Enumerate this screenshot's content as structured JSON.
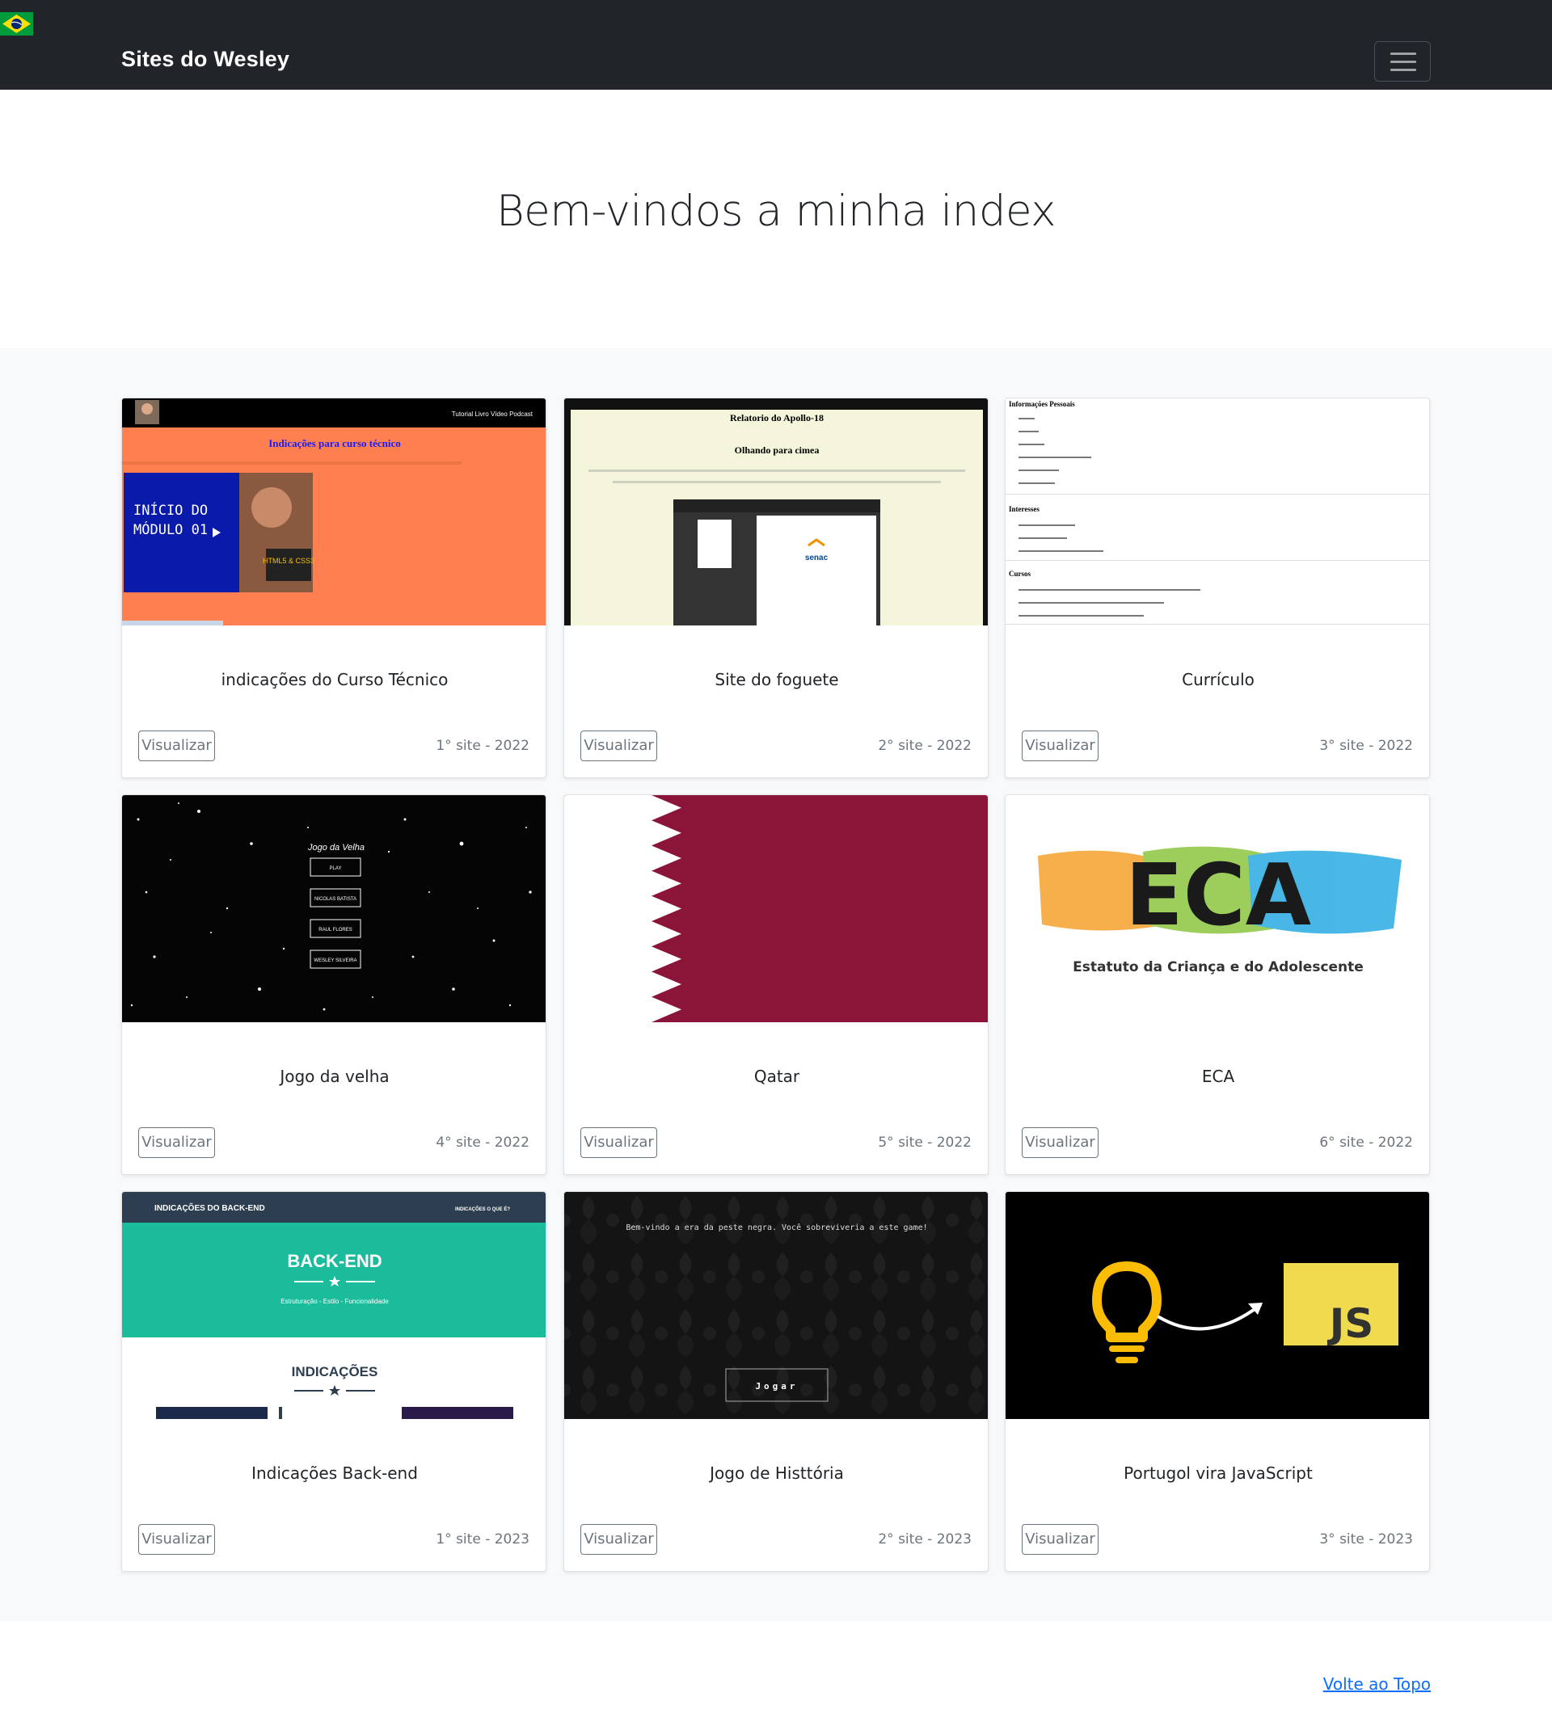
{
  "navbar": {
    "brand": "Sites do Wesley",
    "flag_icon": "brazil-flag-icon",
    "toggler_icon": "hamburger-menu-icon"
  },
  "hero": {
    "title": "Bem-vindos a minha index"
  },
  "cards": [
    {
      "title": "indicações do Curso Técnico",
      "button": "Visualizar",
      "meta": "1° site - 2022"
    },
    {
      "title": "Site do foguete",
      "button": "Visualizar",
      "meta": "2° site - 2022"
    },
    {
      "title": "Currículo",
      "button": "Visualizar",
      "meta": "3° site - 2022"
    },
    {
      "title": "Jogo da velha",
      "button": "Visualizar",
      "meta": "4° site - 2022"
    },
    {
      "title": "Qatar",
      "button": "Visualizar",
      "meta": "5° site - 2022"
    },
    {
      "title": "ECA",
      "button": "Visualizar",
      "meta": "6° site - 2022"
    },
    {
      "title": "Indicações Back-end",
      "button": "Visualizar",
      "meta": "1° site - 2023"
    },
    {
      "title": "Jogo de Histtória",
      "button": "Visualizar",
      "meta": "2° site - 2023"
    },
    {
      "title": "Portugol vira JavaScript",
      "button": "Visualizar",
      "meta": "3° site - 2023"
    }
  ],
  "thumbs": {
    "t1": {
      "nav": "Tutorial  Livro  Vídeo  Podcast",
      "heading": "Indicações para curso técnico",
      "video_line1": "INÍCIO DO",
      "video_line2": "MÓDULO 01",
      "video_badge": "HTML5 & CSS3"
    },
    "t2": {
      "title": "Relatorio do Apollo-18",
      "subtitle": "Olhando para cimea",
      "logo": "senac"
    },
    "t3": {
      "h1": "Informações Pessoais",
      "h2": "Interesses",
      "h3": "Cursos"
    },
    "t4": {
      "title": "Jogo da Velha",
      "b1": "PLAY",
      "b2": "NICOLAS BATISTA",
      "b3": "RAUL FLORES",
      "b4": "WESLEY SILVEIRA"
    },
    "t6": {
      "logo": "ECA",
      "caption": "Estatuto da Criança e do Adolescente"
    },
    "t7": {
      "nav_left": "INDICAÇÕES DO BACK-END",
      "nav_right": "INDICAÇÕES     O QUE É?",
      "hero_title": "BACK-END",
      "hero_sub": "Estruturação - Estilo - Funcionalidade",
      "section": "INDICAÇÕES"
    },
    "t8": {
      "text": "Bem-vindo a era da peste negra. Você sobreviveria a este game!",
      "button": "Jogar"
    },
    "t9": {
      "badge": "JS"
    }
  },
  "footer": {
    "back_to_top": "Volte ao Topo"
  },
  "colors": {
    "navbar_bg": "#212529",
    "album_bg": "#f8f9fa",
    "link": "#0d6efd",
    "muted": "#6c757d",
    "qatar_maroon": "#8a1538",
    "backend_teal": "#1abc9c",
    "js_yellow": "#f0db4f"
  }
}
